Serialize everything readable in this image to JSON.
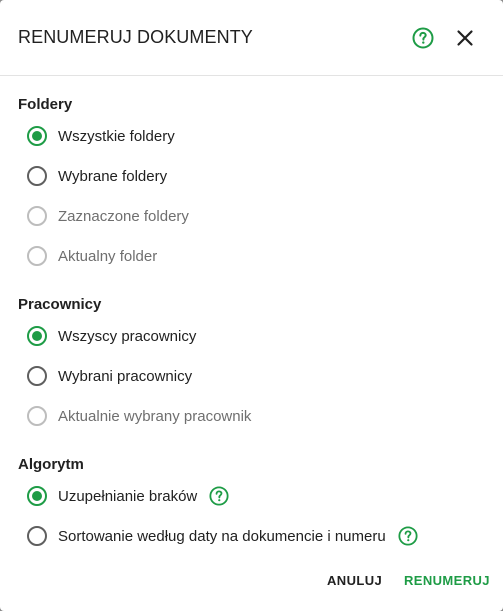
{
  "dialog": {
    "title": "RENUMERUJ DOKUMENTY",
    "accent_color": "#1e9c46"
  },
  "icons": {
    "help": "help-circle-icon",
    "close": "close-icon"
  },
  "sections": {
    "folders": {
      "title": "Foldery",
      "options": [
        {
          "label": "Wszystkie foldery",
          "state": "checked"
        },
        {
          "label": "Wybrane foldery",
          "state": "unchecked"
        },
        {
          "label": "Zaznaczone foldery",
          "state": "disabled"
        },
        {
          "label": "Aktualny folder",
          "state": "disabled"
        }
      ]
    },
    "employees": {
      "title": "Pracownicy",
      "options": [
        {
          "label": "Wszyscy pracownicy",
          "state": "checked"
        },
        {
          "label": "Wybrani pracownicy",
          "state": "unchecked"
        },
        {
          "label": "Aktualnie wybrany pracownik",
          "state": "disabled"
        }
      ]
    },
    "algorithm": {
      "title": "Algorytm",
      "options": [
        {
          "label": "Uzupełnianie braków",
          "state": "checked"
        },
        {
          "label": "Sortowanie według daty na dokumencie i numeru",
          "state": "unchecked"
        }
      ]
    }
  },
  "actions": {
    "cancel_label": "ANULUJ",
    "confirm_label": "RENUMERUJ"
  }
}
